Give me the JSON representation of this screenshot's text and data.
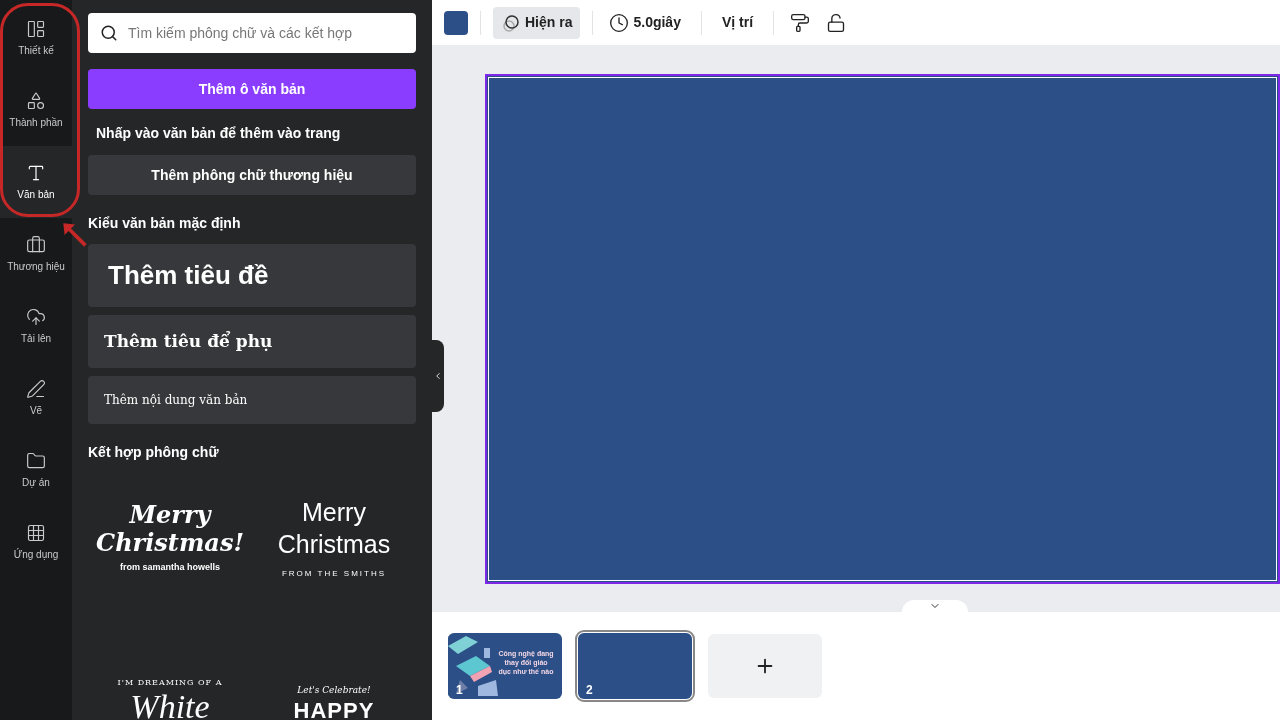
{
  "nav": [
    {
      "label": "Thiết kế",
      "selected": false
    },
    {
      "label": "Thành phần",
      "selected": false
    },
    {
      "label": "Văn bản",
      "selected": true
    },
    {
      "label": "Thương hiệu",
      "selected": false
    },
    {
      "label": "Tải lên",
      "selected": false
    },
    {
      "label": "Vẽ",
      "selected": false
    },
    {
      "label": "Dự án",
      "selected": false
    },
    {
      "label": "Ứng dụng",
      "selected": false
    }
  ],
  "annotation": {
    "kind": "circle-arrow",
    "color": "#c62828"
  },
  "panel": {
    "search": {
      "placeholder": "Tìm kiếm phông chữ và các kết hợp"
    },
    "add_textbox": "Thêm ô văn bản",
    "hint": "Nhấp vào văn bản để thêm vào trang",
    "brand_fonts": "Thêm phông chữ thương hiệu",
    "default_styles_title": "Kiểu văn bản mặc định",
    "styles": [
      {
        "kind": "heading",
        "text": "Thêm tiêu đề"
      },
      {
        "kind": "subheading",
        "text": "Thêm tiêu để phụ"
      },
      {
        "kind": "body",
        "text": "Thêm nội dung văn bản"
      }
    ],
    "combos_title": "Kết hợp phông chữ",
    "combos": [
      {
        "kind": "script",
        "lines": [
          "Merry",
          "Christmas!",
          "from samantha howells"
        ]
      },
      {
        "kind": "light",
        "lines": [
          "Merry",
          "Christmas",
          "FROM THE SMITHS"
        ]
      },
      {
        "kind": "serif",
        "lines": [
          "I'M DREAMING OF A",
          "White"
        ]
      },
      {
        "kind": "outline",
        "lines": [
          "Let's Celebrate!",
          "HAPPY"
        ]
      }
    ]
  },
  "toolbar": {
    "animate": {
      "label": "Hiện ra",
      "selected": true
    },
    "duration": "5.0giây",
    "position": "Vị trí"
  },
  "pages": [
    {
      "number": "1",
      "selected": false,
      "kind": "slide",
      "title": "Công nghệ đang thay đổi giáo dục như thế nào"
    },
    {
      "number": "2",
      "selected": true,
      "kind": "blank"
    }
  ]
}
